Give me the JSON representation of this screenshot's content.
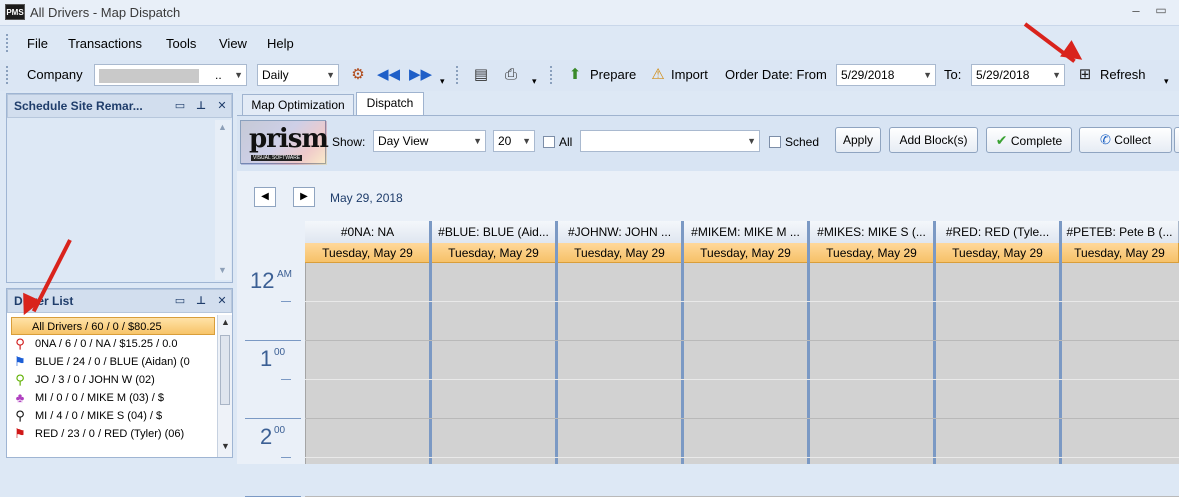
{
  "window": {
    "title": "All Drivers - Map Dispatch",
    "logo_text": "PMS",
    "min_glyph": "–",
    "max_glyph": "▭"
  },
  "menu": [
    "File",
    "Transactions",
    "Tools",
    "View",
    "Help"
  ],
  "toolbar": {
    "company_label": "Company",
    "company_value": "..",
    "period_value": "Daily",
    "prepare_label": "Prepare",
    "import_label": "Import",
    "order_date_from_label": "Order Date: From",
    "from_date": "5/29/2018",
    "to_label": "To:",
    "to_date": "5/29/2018",
    "refresh_label": "Refresh"
  },
  "schedule_panel": {
    "title": "Schedule Site Remar..."
  },
  "driver_panel": {
    "title": "Driver List",
    "selected_index": 0,
    "items": [
      {
        "label": "All Drivers / 60 / 0 / $80.25",
        "icon": "none",
        "color": ""
      },
      {
        "label": "0NA  / 6 / 0 / NA / $15.25 / 0.0",
        "icon": "pin-icon",
        "color": "#d01818"
      },
      {
        "label": "BLUE  / 24 / 0 / BLUE (Aidan) (0",
        "icon": "flag-icon",
        "color": "#1d5fd6"
      },
      {
        "label": "JO         / 3 / 0 / JOHN W (02)",
        "icon": "pin-icon",
        "color": "#5fb000"
      },
      {
        "label": "MI         / 0 / 0 / MIKE M (03) / $",
        "icon": "palm-icon",
        "color": "#b040c0"
      },
      {
        "label": "MI         / 4 / 0 / MIKE S (04) / $",
        "icon": "pin-icon",
        "color": "#111111"
      },
      {
        "label": "RED  / 23 / 0 / RED (Tyler) (06)",
        "icon": "flag-icon",
        "color": "#d01818"
      }
    ]
  },
  "tabs": [
    {
      "label": "Map Optimization",
      "active": false
    },
    {
      "label": "Dispatch",
      "active": true
    }
  ],
  "dispatch_toolbar": {
    "brand_text": "prism",
    "brand_sub": "VISUAL SOFTWARE",
    "show_label": "Show:",
    "view_value": "Day View",
    "count_value": "20",
    "all_label": "All",
    "filter_value": "",
    "sched_label": "Sched",
    "apply_label": "Apply",
    "add_block_label": "Add Block(s)",
    "complete_label": "Complete",
    "collect_label": "Collect"
  },
  "calendar": {
    "date_label": "May 29, 2018",
    "columns": [
      {
        "header": "#0NA: NA",
        "day": "Tuesday, May 29"
      },
      {
        "header": "#BLUE: BLUE (Aid...",
        "day": "Tuesday, May 29"
      },
      {
        "header": "#JOHNW: JOHN ...",
        "day": "Tuesday, May 29"
      },
      {
        "header": "#MIKEM: MIKE M ...",
        "day": "Tuesday, May 29"
      },
      {
        "header": "#MIKES: MIKE S (...",
        "day": "Tuesday, May 29"
      },
      {
        "header": "#RED: RED (Tyle...",
        "day": "Tuesday, May 29"
      },
      {
        "header": "#PETEB: Pete B (...",
        "day": "Tuesday, May 29"
      }
    ],
    "times": [
      {
        "hour": "12",
        "suffix": "AM"
      },
      {
        "hour": "1",
        "suffix": "00"
      },
      {
        "hour": "2",
        "suffix": "00"
      }
    ]
  }
}
